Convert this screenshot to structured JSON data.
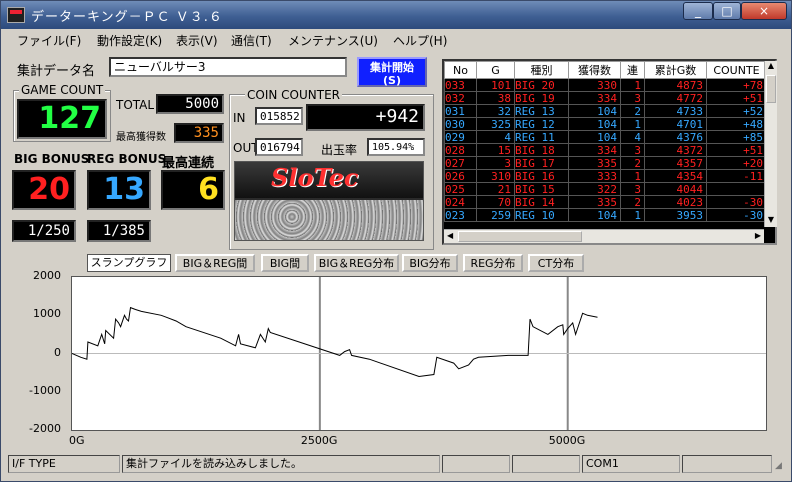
{
  "window": {
    "title": "データーキング－ＰＣ Ｖ３.６"
  },
  "menu": [
    "ファイル(F)",
    "動作設定(K)",
    "表示(V)",
    "通信(T)",
    "メンテナンス(U)",
    "ヘルプ(H)"
  ],
  "header": {
    "data_name_label": "集計データ名",
    "data_name_value": "ニューバルサー3",
    "start_button": "集計開始\n(S)"
  },
  "game_count": {
    "label": "GAME COUNT",
    "value": "127"
  },
  "totals": {
    "total_label": "TOTAL",
    "total_value": "5000",
    "max_label": "最高獲得数",
    "max_value": "335"
  },
  "bonus": {
    "big_label": "BIG BONUS",
    "big_value": "20",
    "big_ratio": "1/250",
    "reg_label": "REG BONUS",
    "reg_value": "13",
    "reg_ratio": "1/385",
    "streak_label": "最高連続",
    "streak_value": "6"
  },
  "coin": {
    "title": "COIN COUNTER",
    "in_label": "IN",
    "in_value": "015852",
    "diff_value": "+942",
    "out_label": "OUT",
    "out_value": "016794",
    "rate_label": "出玉率",
    "rate_value": "105.94%",
    "logo": "SloTec"
  },
  "table": {
    "headers": [
      "No",
      "G",
      "種別",
      "獲得数",
      "連",
      "累計G数",
      "COUNTE"
    ],
    "rows": [
      {
        "no": "033",
        "g": "101",
        "type": "BIG 20",
        "got": "330",
        "ren": "1",
        "cum": "4873",
        "cnt": "+78",
        "color": "#ff2020"
      },
      {
        "no": "032",
        "g": "38",
        "type": "BIG 19",
        "got": "334",
        "ren": "3",
        "cum": "4772",
        "cnt": "+51",
        "color": "#ff2020"
      },
      {
        "no": "031",
        "g": "32",
        "type": "REG 13",
        "got": "104",
        "ren": "2",
        "cum": "4733",
        "cnt": "+52",
        "color": "#36a8ff"
      },
      {
        "no": "030",
        "g": "325",
        "type": "REG 12",
        "got": "104",
        "ren": "1",
        "cum": "4701",
        "cnt": "+48",
        "color": "#36a8ff"
      },
      {
        "no": "029",
        "g": "4",
        "type": "REG 11",
        "got": "104",
        "ren": "4",
        "cum": "4376",
        "cnt": "+85",
        "color": "#36a8ff"
      },
      {
        "no": "028",
        "g": "15",
        "type": "BIG 18",
        "got": "334",
        "ren": "3",
        "cum": "4372",
        "cnt": "+51",
        "color": "#ff2020"
      },
      {
        "no": "027",
        "g": "3",
        "type": "BIG 17",
        "got": "335",
        "ren": "2",
        "cum": "4357",
        "cnt": "+20",
        "color": "#ff2020"
      },
      {
        "no": "026",
        "g": "310",
        "type": "BIG 16",
        "got": "333",
        "ren": "1",
        "cum": "4354",
        "cnt": "-11",
        "color": "#ff2020"
      },
      {
        "no": "025",
        "g": "21",
        "type": "BIG 15",
        "got": "322",
        "ren": "3",
        "cum": "4044",
        "cnt": "",
        "color": "#ff2020"
      },
      {
        "no": "024",
        "g": "70",
        "type": "BIG 14",
        "got": "335",
        "ren": "2",
        "cum": "4023",
        "cnt": "-30",
        "color": "#ff2020"
      },
      {
        "no": "023",
        "g": "259",
        "type": "REG 10",
        "got": "104",
        "ren": "1",
        "cum": "3953",
        "cnt": "-30",
        "color": "#36a8ff"
      }
    ]
  },
  "tabs": [
    "スランプグラフ",
    "BIG＆REG間",
    "BIG間",
    "BIG＆REG分布",
    "BIG分布",
    "REG分布",
    "CT分布"
  ],
  "chart_data": {
    "type": "line",
    "title": "",
    "xlabel": "",
    "ylabel": "",
    "xlim": [
      0,
      7000
    ],
    "ylim": [
      -2000,
      2000
    ],
    "x_ticks": [
      "0G",
      "2500G",
      "5000G"
    ],
    "y_ticks": [
      "2000",
      "1000",
      "0",
      "-1000",
      "-2000"
    ],
    "grid": true,
    "series": [
      {
        "x": [
          0,
          90,
          150,
          160,
          260,
          300,
          330,
          340,
          420,
          440,
          470,
          490,
          530,
          550,
          570,
          590,
          640,
          700,
          900,
          950,
          1050,
          1150,
          1500,
          1650,
          1680,
          1700,
          1850,
          1900,
          1950,
          1980,
          2000,
          2700,
          2750,
          2800,
          2820,
          3000,
          3500,
          3650,
          3680,
          3850,
          3900,
          4000,
          4050,
          4100,
          4400,
          4600,
          4620,
          4650,
          4800,
          4900,
          4950,
          4960,
          5000,
          5050,
          5080,
          5150,
          5200,
          5300
        ],
        "y": [
          0,
          -100,
          -150,
          300,
          200,
          500,
          250,
          600,
          400,
          900,
          800,
          700,
          1000,
          900,
          850,
          1200,
          1150,
          1100,
          1000,
          950,
          850,
          700,
          400,
          200,
          500,
          250,
          150,
          500,
          300,
          650,
          550,
          -50,
          50,
          100,
          -50,
          -150,
          -600,
          -550,
          -100,
          -250,
          -400,
          -300,
          -150,
          -100,
          -50,
          -50,
          900,
          700,
          500,
          700,
          750,
          500,
          650,
          800,
          500,
          1050,
          1000,
          950
        ]
      }
    ]
  },
  "status": {
    "if_type": "I/F TYPE",
    "message": "集計ファイルを読み込みしました。",
    "port": "COM1"
  }
}
